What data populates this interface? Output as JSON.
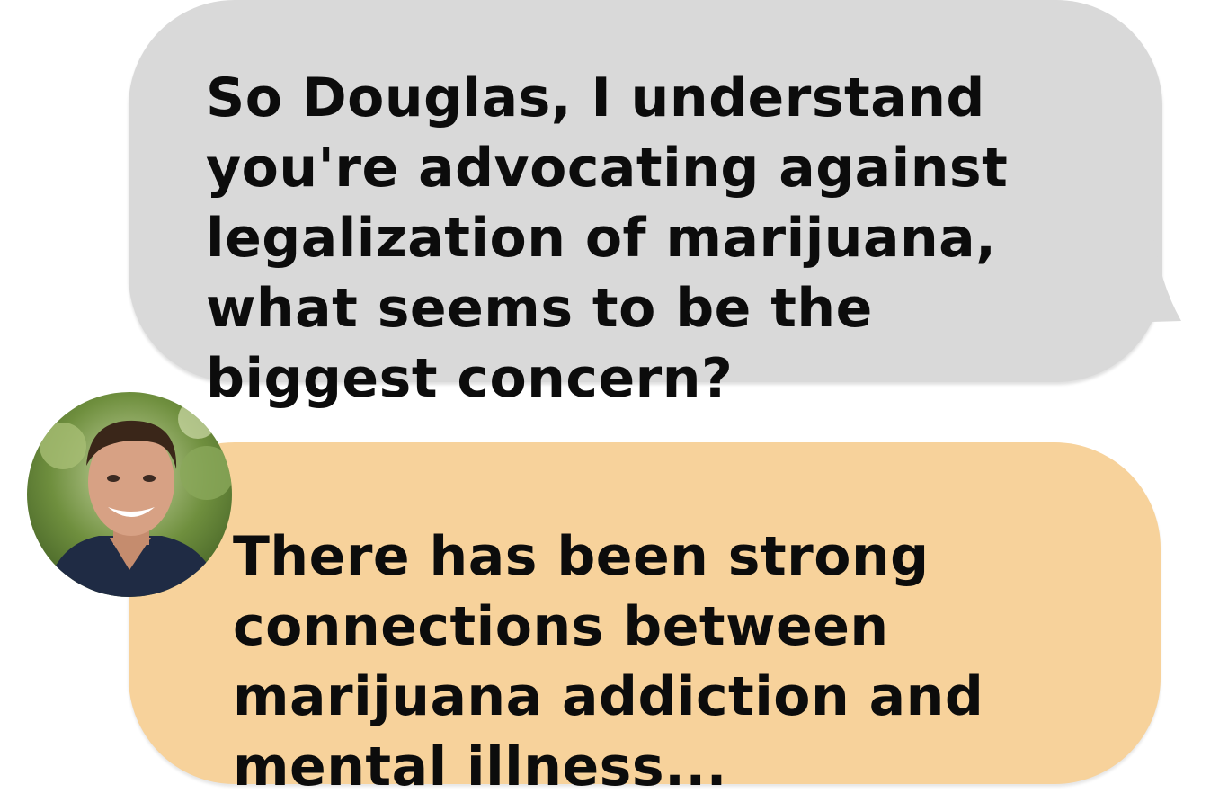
{
  "conversation": {
    "question": {
      "speaker": "interviewer",
      "text": "So Douglas, I understand you're advocating against legalization of marijuana, what seems to be the biggest concern?",
      "color": "#d9d9d9"
    },
    "answer": {
      "speaker": "Douglas",
      "avatar_icon": "person-photo-avatar",
      "text": "There has been strong connections between marijuana addiction and mental illness...",
      "color": "#f7d29b"
    }
  }
}
